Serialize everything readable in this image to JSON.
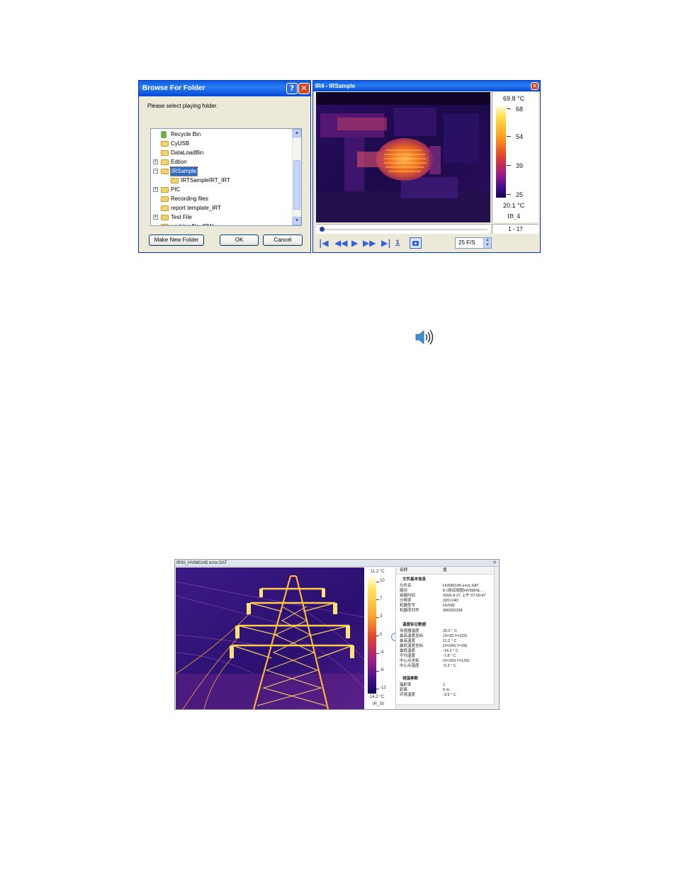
{
  "browse_dialog": {
    "title": "Browse For Folder",
    "help_glyph": "?",
    "close_glyph": "✕",
    "prompt": "Please select playing folder.",
    "tree": [
      {
        "label": "Recycle Bin",
        "icon": "recycle-bin-icon",
        "expander": ""
      },
      {
        "label": "CyUSB",
        "icon": "folder-icon",
        "expander": ""
      },
      {
        "label": "DataLoadBin",
        "icon": "folder-icon",
        "expander": ""
      },
      {
        "label": "Edtion",
        "icon": "folder-icon",
        "expander": "+"
      },
      {
        "label": "IRSample",
        "icon": "folder-icon",
        "expander": "−",
        "selected": true
      },
      {
        "label": "IRTSampleIRT_IRT",
        "icon": "folder-icon",
        "expander": ""
      },
      {
        "label": "PIC",
        "icon": "folder-icon",
        "expander": "+"
      },
      {
        "label": "Recording files",
        "icon": "folder-icon",
        "expander": ""
      },
      {
        "label": "report template_IRT",
        "icon": "folder-icon",
        "expander": ""
      },
      {
        "label": "Test File",
        "icon": "folder-icon",
        "expander": "+"
      },
      {
        "label": "working file_IRW",
        "icon": "folder-icon",
        "expander": ""
      }
    ],
    "buttons": {
      "new_folder": "Make New Folder",
      "ok": "OK",
      "cancel": "Cancel"
    }
  },
  "ir_window": {
    "title": "IR4 - IRSample",
    "close_glyph": "✕",
    "scale": {
      "max": "69.8 °C",
      "ticks": [
        "68",
        "54",
        "39",
        "25"
      ],
      "min": "20.1 °C",
      "device": "IR_4"
    },
    "frame_counter": "1 - 17",
    "fps": "25 F/S",
    "playback_progress": 0.0
  },
  "thermal_window": {
    "title": "IR30_HV680145 error.SAT",
    "scale": {
      "max": "11.2 °C",
      "ticks": [
        "10",
        "7",
        "3",
        "0",
        "-4",
        "-8",
        "-12"
      ],
      "min": "-14.2 °C",
      "device": "IR_30"
    },
    "properties": {
      "col_name": "名称",
      "col_value": "值",
      "sec_file": "文件基本信息",
      "file_rows": [
        {
          "k": "文件名",
          "v": "HV680145 error.SAT"
        },
        {
          "k": "路径",
          "v": "E:\\测试用图\\HV680\\E..."
        },
        {
          "k": "拍摄时间",
          "v": "2009-8-27 上午 07:00:47"
        },
        {
          "k": "分辨率",
          "v": "320×240"
        },
        {
          "k": "机器型号",
          "v": "HV680"
        },
        {
          "k": "机器序列号",
          "v": "680200298"
        }
      ],
      "sec_temp": "温度标记数据",
      "temp_rows": [
        {
          "k": "传感器温度",
          "v": "20.5 ° C"
        },
        {
          "k": "最高温度坐标",
          "v": "(X=33,Y=225)"
        },
        {
          "k": "最高温度",
          "v": "11.2 ° C"
        },
        {
          "k": "最低温度坐标",
          "v": "(X=240,Y=28)"
        },
        {
          "k": "最低温度",
          "v": "-14.2 ° C"
        },
        {
          "k": "平均温度",
          "v": "-7.8 ° C"
        },
        {
          "k": "中心点坐标",
          "v": "(X=160,Y=120)"
        },
        {
          "k": "中心点温度",
          "v": "-5.3 ° C"
        }
      ],
      "sec_measure": "测温参数",
      "measure_rows": [
        {
          "k": "辐射率",
          "v": "1"
        },
        {
          "k": "距离",
          "v": "5 m"
        },
        {
          "k": "环境温度",
          "v": "-3.9 ° C"
        }
      ]
    }
  },
  "colors": {
    "xp_blue": "#0a5ce8",
    "selection": "#316ac5",
    "ctrl_blue": "#3361d6"
  }
}
